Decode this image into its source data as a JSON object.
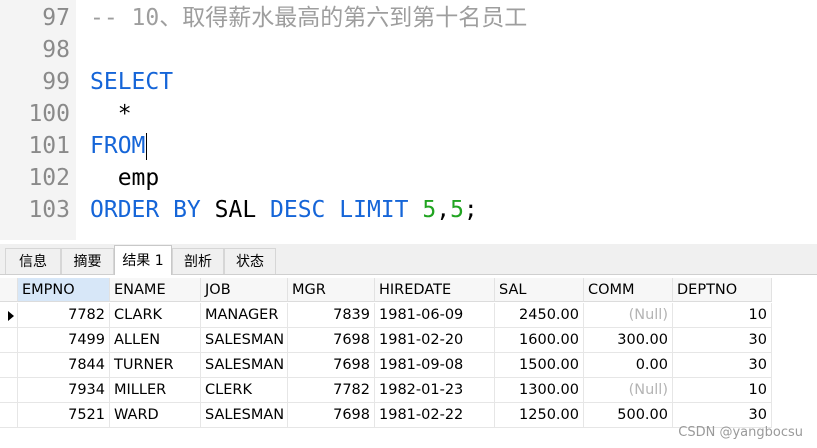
{
  "editor": {
    "lines": [
      {
        "num": "97",
        "tokens": [
          {
            "text": "-- 10、取得薪水最高的第六到第十名员工",
            "color": "#9e9e9e"
          }
        ]
      },
      {
        "num": "98",
        "tokens": []
      },
      {
        "num": "99",
        "tokens": [
          {
            "text": "SELECT",
            "color": "#1565d8"
          }
        ]
      },
      {
        "num": "100",
        "tokens": [
          {
            "text": "  *",
            "color": "#000000"
          }
        ]
      },
      {
        "num": "101",
        "tokens": [
          {
            "text": "FROM",
            "color": "#1565d8"
          }
        ],
        "caret": true
      },
      {
        "num": "102",
        "tokens": [
          {
            "text": "  emp",
            "color": "#000000"
          }
        ]
      },
      {
        "num": "103",
        "tokens": [
          {
            "text": "ORDER BY ",
            "color": "#1565d8"
          },
          {
            "text": "SAL ",
            "color": "#000000"
          },
          {
            "text": "DESC LIMIT ",
            "color": "#1565d8"
          },
          {
            "text": "5",
            "color": "#21a421"
          },
          {
            "text": ",",
            "color": "#000000"
          },
          {
            "text": "5",
            "color": "#21a421"
          },
          {
            "text": ";",
            "color": "#000000"
          }
        ]
      }
    ]
  },
  "tabs": {
    "items": [
      "信息",
      "摘要",
      "结果 1",
      "剖析",
      "状态"
    ],
    "active": 2
  },
  "grid": {
    "columns": [
      "EMPNO",
      "ENAME",
      "JOB",
      "MGR",
      "HIREDATE",
      "SAL",
      "COMM",
      "DEPTNO"
    ],
    "selected_column": 0,
    "rows": [
      [
        "7782",
        "CLARK",
        "MANAGER",
        "7839",
        "1981-06-09",
        "2450.00",
        "(Null)",
        "10"
      ],
      [
        "7499",
        "ALLEN",
        "SALESMAN",
        "7698",
        "1981-02-20",
        "1600.00",
        "300.00",
        "30"
      ],
      [
        "7844",
        "TURNER",
        "SALESMAN",
        "7698",
        "1981-09-08",
        "1500.00",
        "0.00",
        "30"
      ],
      [
        "7934",
        "MILLER",
        "CLERK",
        "7782",
        "1982-01-23",
        "1300.00",
        "(Null)",
        "10"
      ],
      [
        "7521",
        "WARD",
        "SALESMAN",
        "7698",
        "1981-02-22",
        "1250.00",
        "500.00",
        "30"
      ]
    ],
    "current_row": 0
  },
  "watermark": "CSDN @yangbocsu"
}
